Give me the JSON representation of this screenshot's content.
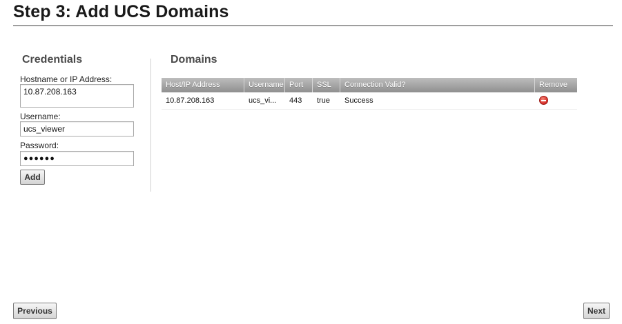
{
  "page": {
    "title": "Step 3: Add UCS Domains"
  },
  "credentials": {
    "heading": "Credentials",
    "hostname_label": "Hostname or IP Address:",
    "hostname_value": "10.87.208.163",
    "username_label": "Username:",
    "username_value": "ucs_viewer",
    "password_label": "Password:",
    "password_value": "●●●●●●",
    "add_label": "Add"
  },
  "domains": {
    "heading": "Domains",
    "columns": [
      "Host/IP Address",
      "Username",
      "Port",
      "SSL",
      "Connection Valid?",
      "Remove"
    ],
    "rows": [
      {
        "host": "10.87.208.163",
        "username": "ucs_vi...",
        "port": "443",
        "ssl": "true",
        "valid": "Success",
        "remove_icon": "remove-circle-icon"
      }
    ]
  },
  "footer": {
    "previous_label": "Previous",
    "next_label": "Next"
  },
  "colors": {
    "header_bar": "#a6a6a6",
    "remove_icon": "#d8302a"
  }
}
